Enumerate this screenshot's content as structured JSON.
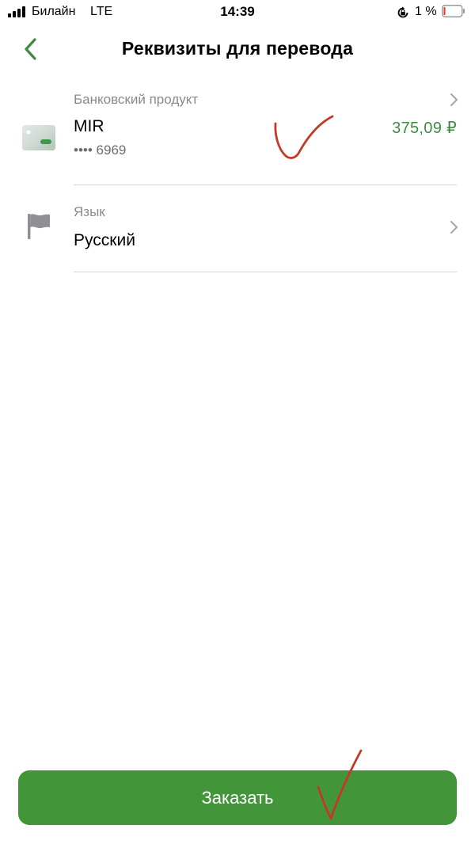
{
  "status_bar": {
    "carrier": "Билайн",
    "network": "LTE",
    "time": "14:39",
    "battery_percent": "1 %",
    "icons": [
      "signal-icon",
      "rotation-lock-icon",
      "battery-icon"
    ]
  },
  "header": {
    "title": "Реквизиты для перевода",
    "back_icon": "chevron-left-icon"
  },
  "product_row": {
    "caption": "Банковский продукт",
    "name": "MIR",
    "card_number": "•••• 6969",
    "balance": "375,09 ₽",
    "icon": "card-icon"
  },
  "language_row": {
    "caption": "Язык",
    "value": "Русский",
    "icon": "flag-icon"
  },
  "order_button": {
    "label": "Заказать"
  },
  "colors": {
    "accent_green": "#439539",
    "amount_green": "#3d8c40",
    "annotation_red": "#c0392b",
    "divider": "#d6d6d6",
    "caption_gray": "#8a8a8e"
  }
}
